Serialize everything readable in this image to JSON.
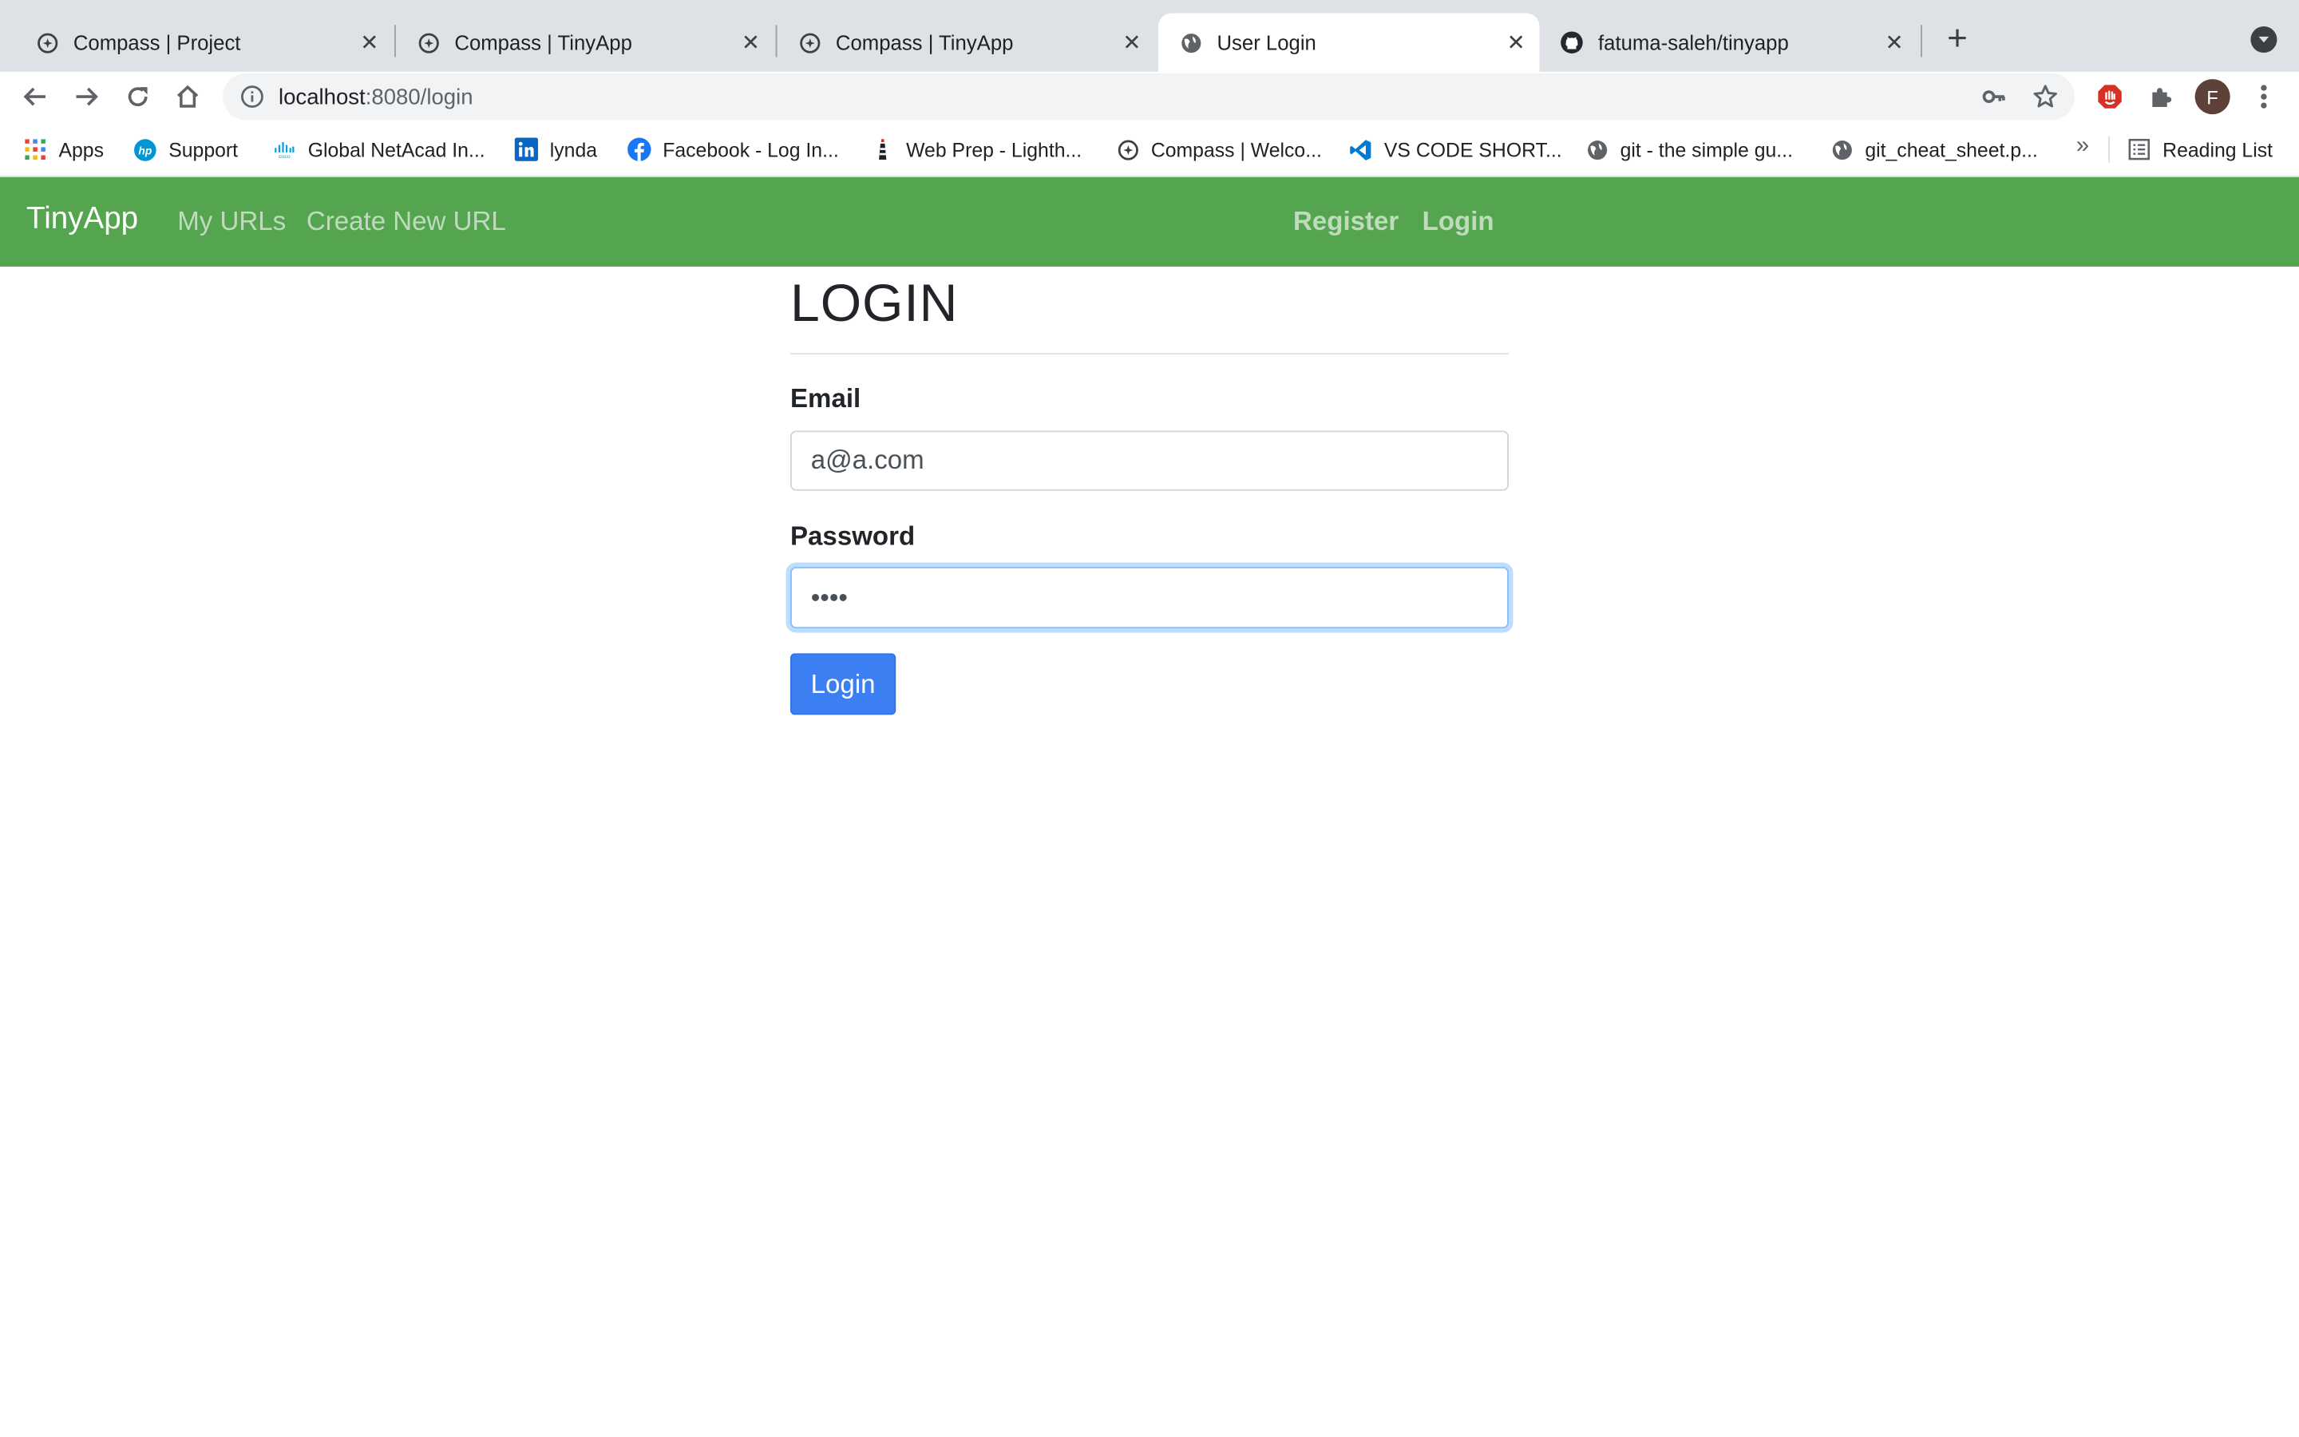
{
  "browser": {
    "tabs": [
      {
        "title": "Compass | Project",
        "icon": "compass-icon",
        "active": false
      },
      {
        "title": "Compass | TinyApp",
        "icon": "compass-icon",
        "active": false
      },
      {
        "title": "Compass | TinyApp",
        "icon": "compass-icon",
        "active": false
      },
      {
        "title": "User Login",
        "icon": "globe-icon",
        "active": true
      },
      {
        "title": "fatuma-saleh/tinyapp",
        "icon": "github-icon",
        "active": false
      }
    ],
    "url_host": "localhost",
    "url_path": ":8080/login",
    "profile_initial": "F",
    "bookmarks": [
      {
        "label": "Apps",
        "icon": "apps-grid-icon"
      },
      {
        "label": "Support",
        "icon": "hp-icon"
      },
      {
        "label": "Global NetAcad In...",
        "icon": "cisco-icon"
      },
      {
        "label": "lynda",
        "icon": "linkedin-icon"
      },
      {
        "label": "Facebook - Log In...",
        "icon": "facebook-icon"
      },
      {
        "label": "Web Prep - Lighth...",
        "icon": "lighthouse-icon"
      },
      {
        "label": "Compass | Welco...",
        "icon": "compass-icon"
      },
      {
        "label": "VS CODE SHORT...",
        "icon": "vscode-icon"
      },
      {
        "label": "git - the simple gu...",
        "icon": "globe-icon"
      },
      {
        "label": "git_cheat_sheet.p...",
        "icon": "globe-icon"
      }
    ],
    "more_bookmarks": "»",
    "reading_list": "Reading List"
  },
  "navbar": {
    "brand": "TinyApp",
    "my_urls": "My URLs",
    "create_url": "Create New URL",
    "register": "Register",
    "login": "Login"
  },
  "form": {
    "title": "LOGIN",
    "email_label": "Email",
    "email_value": "a@a.com",
    "password_label": "Password",
    "password_value": "••••",
    "submit_label": "Login"
  },
  "colors": {
    "navbar_bg": "#55a44f",
    "button_bg": "#3c7ff3",
    "focus_ring": "#80bdff"
  }
}
